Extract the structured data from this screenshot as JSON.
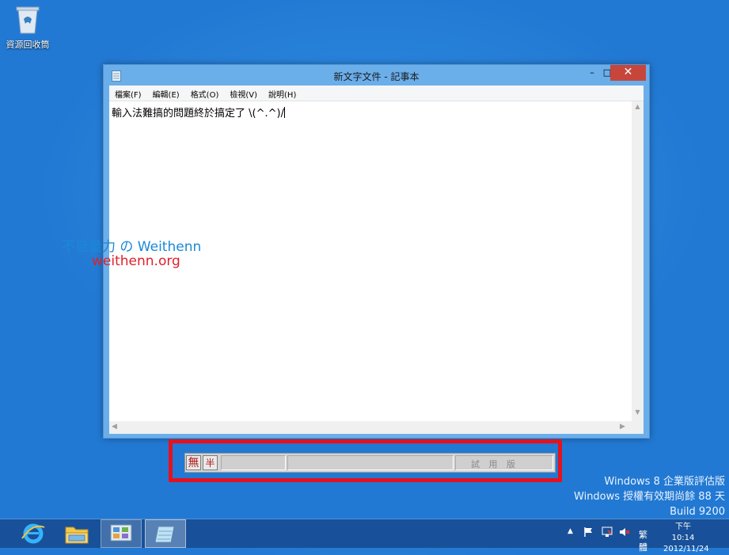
{
  "desktop": {
    "recycle_bin_label": "資源回收筒",
    "watermark_line1": "不自量力 の Weithenn",
    "watermark_line2": "weithenn.org"
  },
  "notepad": {
    "title": "新文字文件 - 記事本",
    "controls": {
      "minimize": "–",
      "maximize": "□",
      "close": "✕"
    },
    "menu": [
      {
        "label": "檔案(F)"
      },
      {
        "label": "編輯(E)"
      },
      {
        "label": "格式(O)"
      },
      {
        "label": "檢視(V)"
      },
      {
        "label": "說明(H)"
      }
    ],
    "content": "輸入法難搞的問題終於搞定了 \\(^.^)/"
  },
  "ime_bar": {
    "mode_key": "無",
    "width_key": "半",
    "trial_label": "試 用 版"
  },
  "eval_notice": {
    "line1": "Windows 8 企業版評估版",
    "line2": "Windows 授權有效期尚餘 88 天",
    "line3": "Build 9200"
  },
  "taskbar": {
    "items": [
      {
        "name": "internet-explorer",
        "icon": "ie-icon"
      },
      {
        "name": "file-explorer",
        "icon": "folder-icon"
      },
      {
        "name": "control-panel",
        "icon": "control-panel-icon"
      },
      {
        "name": "notepad",
        "icon": "notepad-icon"
      }
    ],
    "tray": {
      "ime_indicator": "繁體",
      "time": "下午 10:14",
      "date": "2012/11/24"
    }
  },
  "colors": {
    "desktop_bg": "#2b86dc",
    "window_frame": "#6aaeea",
    "close_button": "#c7463c",
    "highlight_box": "#e4121e",
    "watermark_blue": "#1a88d8",
    "watermark_red": "#e0202a"
  }
}
